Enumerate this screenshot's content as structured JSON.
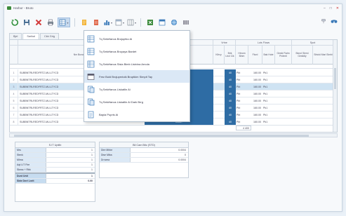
{
  "window": {
    "title": "Harbor - Bruto"
  },
  "tabs": [
    "Bjel",
    "Sarikal",
    "Ckb Grig"
  ],
  "grid": {
    "super_headers": [
      "Vrtne",
      "Lots Flows",
      "Spot"
    ],
    "columns": [
      "Nm Bunaranic",
      "Dank Spidimsn",
      "Kihvy",
      "Brik Lbol Cik",
      "Hbrom Binm",
      "Flurd",
      "Bak Hote",
      "Gestk Fialm Prdenti",
      "Bicrol Slemi Gestidly",
      "Shtold Mari Simbi"
    ],
    "rows": [
      {
        "n": "1",
        "code": "SUBBNTRLREDFRTZ-MU-LTYCD",
        "q": "CAMT",
        "v": "40",
        "s": "Pkt",
        "p": "160.00",
        "c": "Pk1"
      },
      {
        "n": "2",
        "code": "SUBBNTRLREDFRTZ-MU-LTYCD",
        "q": "CAMT",
        "v": "40",
        "s": "Pkt",
        "p": "160.00",
        "c": "Pk1"
      },
      {
        "n": "3",
        "code": "SUBBNTRLREDFRTZ-MU-LTYCD",
        "q": "CAMT",
        "v": "40",
        "s": "Pkt",
        "p": "160.00",
        "c": "Pk1"
      },
      {
        "n": "4",
        "code": "SUBBNTRLREDFRTZ-MU-LTYCD",
        "q": "CAMT",
        "v": "40",
        "s": "Pkt",
        "p": "160.00",
        "c": "Pk1"
      },
      {
        "n": "5",
        "code": "SUBBNTRLREDFRTZ-MU-LTYCD",
        "q": "CAMT",
        "v": "40",
        "s": "Pkt",
        "p": "160.00",
        "c": "Pk1"
      },
      {
        "n": "6",
        "code": "SUBBNTRLREDFRTZ-MU-LTYCD",
        "q": "CAMT",
        "v": "40",
        "s": "Pkt",
        "p": "160.00",
        "c": "Pk1"
      },
      {
        "n": "7",
        "code": "SUBBNTRLREDFRTZ-MU-LTYCD",
        "q": "CAMT",
        "v": "40",
        "s": "Pkt",
        "p": "160.00",
        "c": "Pk1"
      },
      {
        "n": "8",
        "code": "SUBBNTRLREDFRTZ-MU-LTYCD",
        "q": "CAMT",
        "v": "40",
        "s": "Pkt",
        "p": "160.00",
        "c": "Pk1"
      }
    ],
    "total": "4 400"
  },
  "dropdown": {
    "items": [
      {
        "label": "Tq Sekirfanus Brojuptko Ai",
        "icon": "list-icon"
      },
      {
        "label": "Tq Sekirfanus Bruyaya Bardet",
        "icon": "list-icon"
      },
      {
        "label": "Tq Sekirfanus Sisia Bimb Listvina Arnola",
        "icon": "list-icon"
      },
      {
        "label": "Fesr Buld Brojuprntoik Bruptkim Simpit Tay",
        "icon": "window-icon"
      },
      {
        "label": "Tq Sekirfanus Liskatlin Ai",
        "icon": "document-icon"
      },
      {
        "label": "Tq Sekirfanus Liskatlin Ai Dark Brrg",
        "icon": "document-icon"
      },
      {
        "label": "Bapia Pupris Ai",
        "icon": "page-icon"
      }
    ]
  },
  "left_table": {
    "title": "S.IT Uptilb",
    "rows": [
      {
        "label": "Mrs",
        "value": "1"
      },
      {
        "label": "Stenk",
        "value": "1"
      },
      {
        "label": "Mlrna",
        "value": "1"
      },
      {
        "label": "Aqt LIT Fire",
        "value": "1"
      },
      {
        "label": "Sknss + Rbk",
        "value": "1"
      },
      {
        "label": "Dunt Unit",
        "value": "1"
      },
      {
        "label": "Sbte Dnrt Lnrit",
        "value": "0.00"
      }
    ]
  },
  "right_table": {
    "title": "Bil Cam Btic (STD)",
    "rows": [
      {
        "label": "Dire Mhbe",
        "value": "0.0004"
      },
      {
        "label": "Dise Miba",
        "value": "0"
      },
      {
        "label": "Dr.wrea",
        "value": "0.0004"
      }
    ]
  }
}
